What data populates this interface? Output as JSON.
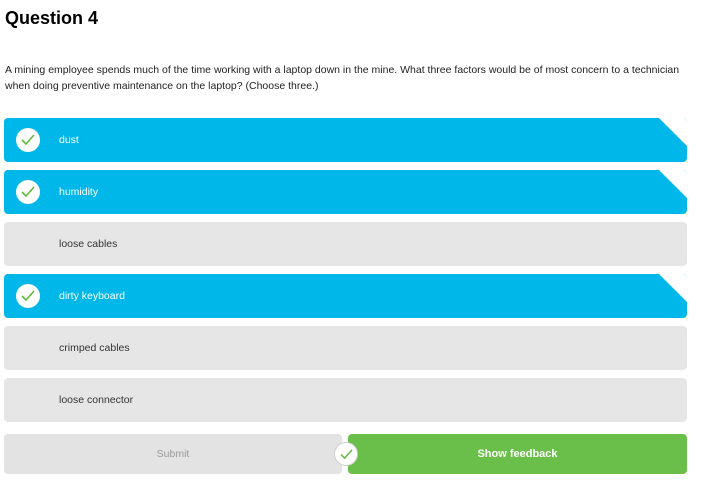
{
  "question": {
    "title": "Question 4",
    "prompt": "A mining employee spends much of the time working with a laptop down in the mine. What three factors would be of most concern to a technician when doing preventive maintenance on the laptop? (Choose three.)"
  },
  "options": [
    {
      "label": "dust",
      "selected": true
    },
    {
      "label": "humidity",
      "selected": true
    },
    {
      "label": "loose cables",
      "selected": false
    },
    {
      "label": "dirty keyboard",
      "selected": true
    },
    {
      "label": "crimped cables",
      "selected": false
    },
    {
      "label": "loose connector",
      "selected": false
    }
  ],
  "buttons": {
    "submit_label": "Submit",
    "feedback_label": "Show feedback"
  },
  "colors": {
    "selected": "#00b7e9",
    "unselected": "#e6e6e6",
    "feedback": "#6abf4b",
    "check": "#5fb840"
  },
  "icons": {
    "option_check": "checkmark-icon",
    "status": "checkmark-circle-icon"
  }
}
